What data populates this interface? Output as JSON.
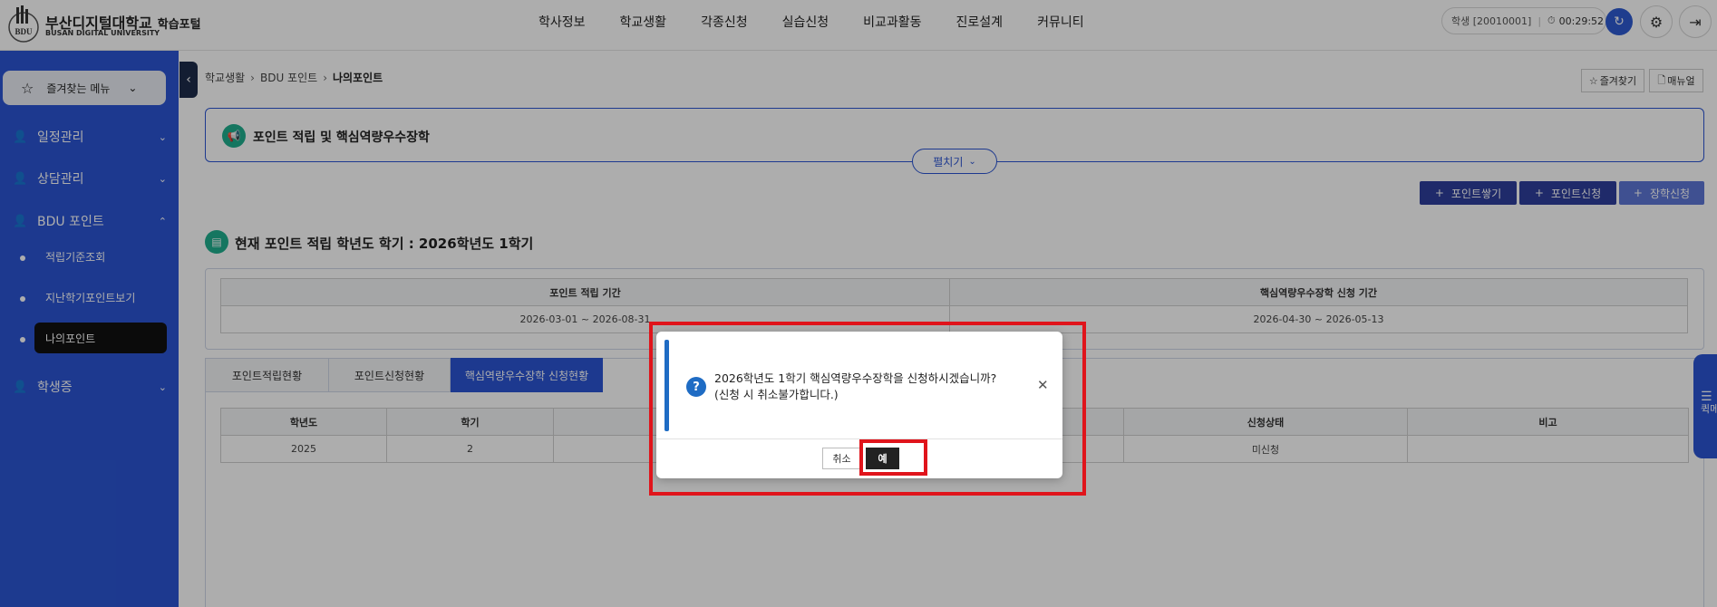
{
  "header": {
    "school_name": "부산디지털대학교",
    "portal_label": "학습포털",
    "school_name_en": "BUSAN DIGITAL UNIVERSITY",
    "logo_text": "BDU",
    "gnb": [
      "학사정보",
      "학교생활",
      "각종신청",
      "실습신청",
      "비교과활동",
      "진로설계",
      "커뮤니티"
    ],
    "user_label": "학생 [20010001]",
    "timer": "00:29:52"
  },
  "sidebar": {
    "favorites_label": "즐겨찾는 메뉴",
    "menus": [
      {
        "label": "일정관리",
        "chevron": "chevron-down-icon"
      },
      {
        "label": "상담관리",
        "chevron": "chevron-down-icon"
      },
      {
        "label": "BDU 포인트",
        "chevron": "chevron-up-icon"
      },
      {
        "label": "학생증",
        "chevron": "chevron-down-icon"
      }
    ],
    "submenu": [
      "적립기준조회",
      "지난학기포인트보기",
      "나의포인트"
    ]
  },
  "breadcrumb": {
    "items": [
      "학교생활",
      "BDU 포인트"
    ],
    "current": "나의포인트"
  },
  "top_buttons": {
    "favorite": "즐겨찾기",
    "manual": "매뉴얼"
  },
  "notice": {
    "title": "포인트 적립 및 핵심역량우수장학",
    "expand_label": "펼치기"
  },
  "actions": {
    "points_earn": "포인트쌓기",
    "points_apply": "포인트신청",
    "scholarship_apply": "장학신청"
  },
  "section": {
    "title": "현재 포인트 적립 학년도 학기 : 2026학년도 1학기"
  },
  "period": {
    "headers": [
      "포인트 적립 기간",
      "핵심역량우수장학 신청 기간"
    ],
    "values": [
      "2026-03-01 ~ 2026-08-31",
      "2026-04-30 ~ 2026-05-13"
    ]
  },
  "tabs": [
    "포인트적립현황",
    "포인트신청현황",
    "핵심역량우수장학 신청현황"
  ],
  "list": {
    "headers": [
      "학년도",
      "학기",
      "신청상태",
      "비고"
    ],
    "row": [
      "2025",
      "2",
      "미신청",
      ""
    ]
  },
  "right_float": {
    "label": "퀵메"
  },
  "dialog": {
    "line1": "2026학년도 1학기 핵심역량우수장학을 신청하시겠습니까?",
    "line2": "(신청 시 취소불가합니다.)",
    "cancel_label": "취소",
    "ok_label": "예",
    "question_mark": "?"
  },
  "colors": {
    "accent": "#2b55d3",
    "highlight": "#e0141b",
    "notice_icon": "#1fae8e"
  }
}
